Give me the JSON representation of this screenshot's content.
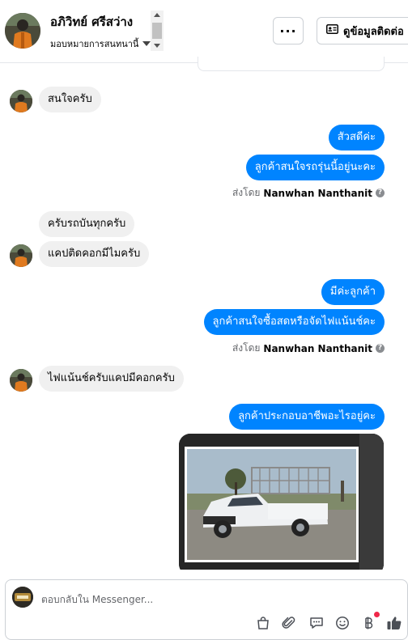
{
  "header": {
    "name": "อภิวิทย์ ศรีสว่าง",
    "assign_label": "มอบหมายการสนทนานี้",
    "more_label": "···",
    "contact_button": "ดูข้อมูลติดต่อ"
  },
  "messages": [
    {
      "id": "m1",
      "direction": "in",
      "text": "สนใจครับ"
    },
    {
      "id": "m2",
      "direction": "out",
      "text": "สัวสดีค่ะ"
    },
    {
      "id": "m3",
      "direction": "out",
      "text": "ลูกค้าสนใจรถรุ่นนี้อยู่นะคะ"
    },
    {
      "id": "m4",
      "direction": "in",
      "text": "ครับรถบันทุกครับ"
    },
    {
      "id": "m5",
      "direction": "in",
      "text": "แคปติดคอกมีไมครับ"
    },
    {
      "id": "m6",
      "direction": "out",
      "text": "มีค่ะลูกค้า"
    },
    {
      "id": "m7",
      "direction": "out",
      "text": "ลูกค้าสนใจซื้อสดหรือจัดไฟแน้นช์คะ"
    },
    {
      "id": "m8",
      "direction": "in",
      "text": "ไฟแน้นช์ครับแคปมีคอกครับ"
    },
    {
      "id": "m9",
      "direction": "out",
      "text": "ลูกค้าประกอบอาชีพอะไรอยู่คะ"
    }
  ],
  "sent_by": {
    "prefix": "ส่งโดย",
    "agent": "Nanwhan Nanthanit"
  },
  "composer": {
    "placeholder": "ตอบกลับใน Messenger..."
  },
  "colors": {
    "accent": "#0084ff",
    "incoming_bubble": "#f0f0f0",
    "notification_dot": "#f02849"
  },
  "icons": [
    "chevron-down-icon",
    "more-icon",
    "contact-card-icon",
    "help-icon",
    "shopping-bag-icon",
    "attachment-icon",
    "saved-reply-icon",
    "emoji-icon",
    "currency-icon",
    "thumbs-up-icon"
  ]
}
